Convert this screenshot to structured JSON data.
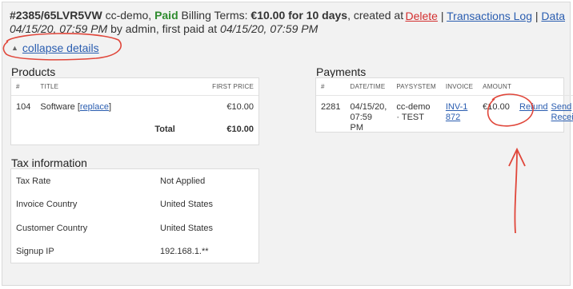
{
  "header": {
    "id": "#2385/65LVR5VW",
    "paysys": "cc-demo,",
    "status": "Paid",
    "terms_label": "Billing Terms:",
    "terms_value": "€10.00 for 10 days",
    "created_label": ", created at",
    "created_date": "04/15/20, 07:59 PM",
    "by_text": "by admin, first paid at",
    "paid_date": "04/15/20, 07:59 PM"
  },
  "actions": {
    "delete": "Delete",
    "sep1": "|",
    "log": "Transactions Log",
    "sep2": "|",
    "data": "Data"
  },
  "collapse": {
    "label": "collapse details"
  },
  "products": {
    "title": "Products",
    "columns": [
      "#",
      "TITLE",
      "FIRST PRICE"
    ],
    "row": {
      "id": "104",
      "name": "Software",
      "bracket_open": "[",
      "replace": "replace",
      "bracket_close": "]",
      "price": "€10.00"
    },
    "total_label": "Total",
    "total_value": "€10.00"
  },
  "tax": {
    "title": "Tax information",
    "rows": [
      {
        "label": "Tax Rate",
        "value": "Not Applied"
      },
      {
        "label": "Invoice Country",
        "value": "United States"
      },
      {
        "label": "Customer Country",
        "value": "United States"
      },
      {
        "label": "Signup IP",
        "value": "192.168.1.**"
      }
    ]
  },
  "payments": {
    "title": "Payments",
    "columns": [
      "#",
      "DATE/TIME",
      "PAYSYSTEM",
      "INVOICE",
      "AMOUNT"
    ],
    "row": {
      "id": "2281",
      "date": "04/15/20,",
      "time": "07:59 PM",
      "paysys_1": "cc-demo",
      "paysys_2": "· TEST",
      "invoice_1": "INV-1",
      "invoice_2": "872",
      "amount": "€10.00",
      "refund": "Refund",
      "send_1": "Send",
      "send_2": "Receipt"
    }
  },
  "colors": {
    "link": "#2a5db0",
    "paid": "#2e8b2e",
    "delete": "#d32f2f",
    "annotation": "#e0463a"
  }
}
